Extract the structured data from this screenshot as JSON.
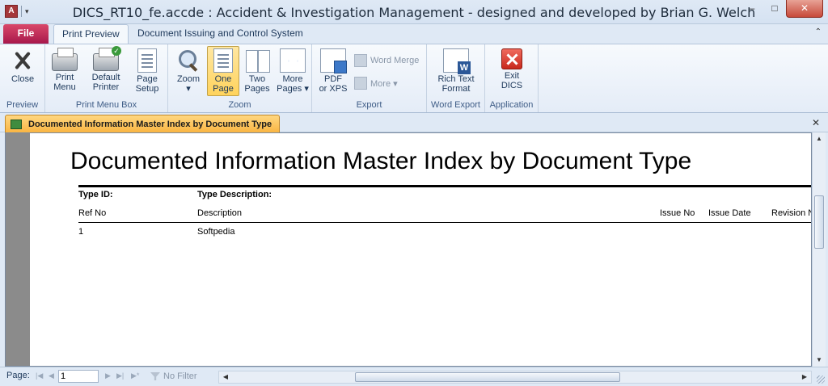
{
  "window": {
    "title": "DICS_RT10_fe.accde : Accident & Investigation Management - designed and developed by Brian G. Welch",
    "minimize": "–",
    "maximize": "□",
    "close": "✕"
  },
  "tabs": {
    "file": "File",
    "print_preview": "Print Preview",
    "document_issuing": "Document Issuing and Control System"
  },
  "ribbon": {
    "preview": {
      "label": "Preview",
      "close": "Close"
    },
    "print_menu_box": {
      "label": "Print Menu Box",
      "print_menu": "Print\nMenu",
      "default_printer": "Default\nPrinter",
      "page_setup": "Page\nSetup"
    },
    "zoom": {
      "label": "Zoom",
      "zoom": "Zoom\n▾",
      "one_page": "One\nPage",
      "two_pages": "Two\nPages",
      "more_pages": "More\nPages ▾"
    },
    "export": {
      "label": "Export",
      "pdf_xps": "PDF\nor XPS",
      "word_merge": "Word Merge",
      "more": "More ▾"
    },
    "word_export": {
      "label": "Word Export",
      "rich_text": "Rich Text\nFormat"
    },
    "application": {
      "label": "Application",
      "exit": "Exit\nDICS"
    }
  },
  "document_tab": {
    "title": "Documented Information Master Index by Document Type",
    "close": "✕"
  },
  "report": {
    "title": "Documented Information Master Index by Document Type",
    "group_headers": {
      "type_id": "Type ID:",
      "type_description": "Type Description:"
    },
    "columns": {
      "ref_no": "Ref No",
      "description": "Description",
      "issue_no": "Issue No",
      "issue_date": "Issue Date",
      "revision_no": "Revision N"
    },
    "rows": [
      {
        "ref_no": "1",
        "description": "Softpedia"
      }
    ]
  },
  "navigation": {
    "page_label": "Page:",
    "page_value": "1",
    "filter_label": "No Filter"
  }
}
